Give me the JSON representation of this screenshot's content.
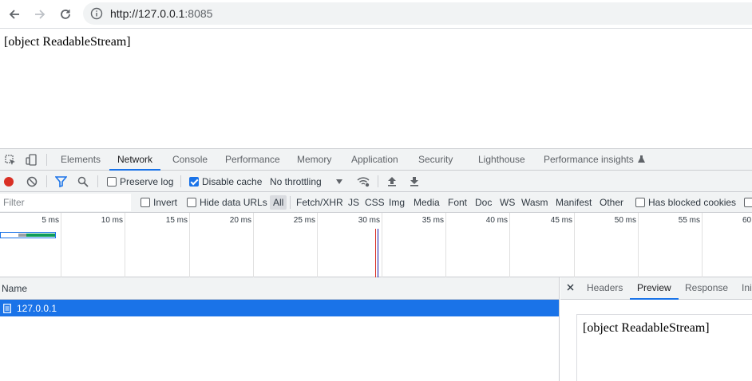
{
  "browser": {
    "url_scheme_host": "http://127.0.0.1",
    "url_port": ":8085"
  },
  "page": {
    "body_text": "[object ReadableStream]"
  },
  "devtools": {
    "tabs": [
      "Elements",
      "Network",
      "Console",
      "Performance",
      "Memory",
      "Application",
      "Security",
      "Lighthouse",
      "Performance insights"
    ],
    "active_tab": "Network",
    "toolbar": {
      "preserve_log": "Preserve log",
      "disable_cache": "Disable cache",
      "throttling": "No throttling"
    },
    "filter": {
      "placeholder": "Filter",
      "invert": "Invert",
      "hide_data_urls": "Hide data URLs",
      "types": [
        "All",
        "Fetch/XHR",
        "JS",
        "CSS",
        "Img",
        "Media",
        "Font",
        "Doc",
        "WS",
        "Wasm",
        "Manifest",
        "Other"
      ],
      "has_blocked_cookies": "Has blocked cookies"
    },
    "timeline_ticks": [
      "5 ms",
      "10 ms",
      "15 ms",
      "20 ms",
      "25 ms",
      "30 ms",
      "35 ms",
      "40 ms",
      "45 ms",
      "50 ms",
      "55 ms",
      "60"
    ],
    "requests": {
      "name_header": "Name",
      "rows": [
        "127.0.0.1"
      ]
    },
    "detail": {
      "tabs": [
        "Headers",
        "Preview",
        "Response",
        "Ini"
      ],
      "active": "Preview",
      "preview_text": "[object ReadableStream]"
    }
  },
  "colors": {
    "accent": "#1a73e8",
    "record": "#d93025"
  }
}
